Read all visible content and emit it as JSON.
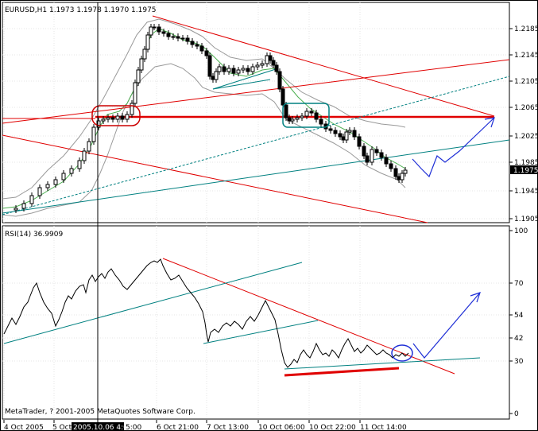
{
  "main_panel": {
    "header": "EURUSD,H1  1.1973 1.1978 1.1970 1.1975",
    "price_ticks": [
      "1.2185",
      "1.2145",
      "1.2105",
      "1.2065",
      "1.2025",
      "1.1985",
      "1.1945",
      "1.1905"
    ],
    "current_price": "1.1975"
  },
  "rsi_panel": {
    "header": "RSI(14) 36.9909",
    "level_ticks": [
      "100",
      "70",
      "54",
      "42",
      "30",
      "0"
    ],
    "copyright": "MetaTrader, ? 2001-2005 MetaQuotes Software Corp."
  },
  "time_axis": {
    "labels": [
      "4 Oct 2005",
      "5 Oct 2005",
      "6 Oct 21:00",
      "7 Oct 13:00",
      "10 Oct 06:00",
      "10 Oct 22:00",
      "11 Oct 14:00"
    ],
    "cursor_label": "2005.10.06 4:00",
    "cursor_label_suffix": "5:00"
  },
  "colors": {
    "background": "#ffffff",
    "grid": "#d6d6d6",
    "candle": "#000000",
    "bollinger": "#999999",
    "moving_average": "#4caf50",
    "trend_red": "#e00000",
    "trend_teal": "#008080",
    "forecast_blue": "#1f2fd6",
    "highlight_box_red": "#cc0000",
    "highlight_box_teal": "#008080",
    "current_price_box": "#000000"
  }
}
